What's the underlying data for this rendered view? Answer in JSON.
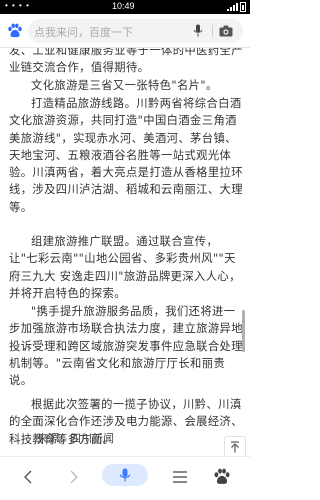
{
  "status_bar": {
    "time": "10:49",
    "notification_dots": "• • • •"
  },
  "search": {
    "placeholder": "点我来问，百度一下"
  },
  "article": {
    "paragraphs": [
      "发、工业和健康服务业等于一体的中医药全产业链交流合作，值得期待。",
      "文化旅游是三省又一张特色\"名片\"。",
      "打造精品旅游线路。川黔两省将综合白酒文化旅游资源，共同打造\"中国白酒金三角酒美旅游线\"，实现赤水河、美酒河、茅台镇、天地宝河、五粮液酒谷名胜等一站式观光体验。川滇两省，着大亮点是打造从香格里拉环线，涉及四川泸沽湖、稻城和云南丽江、大理等。",
      "组建旅游推广联盟。通过联合宣传，让\"七彩云南\"\"山地公园省、多彩贵州风\"\"天府三九大 安逸走四川\"旅游品牌更深入人心，并将开启特色的探索。",
      "\"携手提升旅游服务品质，我们还将进一步加强旅游市场联合执法力度，建立旅游异地投诉受理和跨区域旅游突发事件应急联合处理机制等。\"云南省文化和旅游厅厅长和丽贵说。",
      "根据此次签署的一揽子协议，川黔、川滇的全面深化合作还涉及电力能源、会展经济、科技教育等多方面。"
    ],
    "source": "来源：四川新闻"
  },
  "colors": {
    "accent": "#3b7cff",
    "paw_blue": "#2f6bff",
    "text": "#333333",
    "status_bg": "#000000"
  },
  "icons": {
    "logo": "baidu-paw-icon",
    "mic": "mic-icon",
    "camera": "camera-icon",
    "back": "chevron-left-icon",
    "forward": "chevron-right-icon",
    "menu": "menu-icon",
    "home": "paw-home-icon",
    "top": "back-to-top-icon"
  }
}
